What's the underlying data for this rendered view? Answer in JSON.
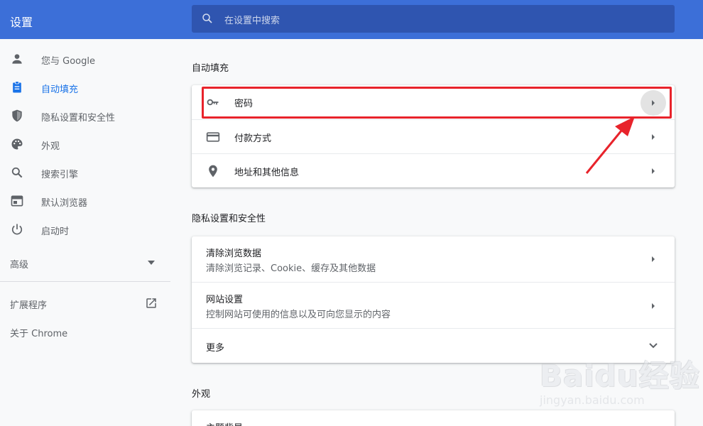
{
  "app": {
    "title": "设置"
  },
  "search": {
    "placeholder": "在设置中搜索"
  },
  "sidebar": {
    "items": [
      {
        "label": "您与 Google",
        "icon": "person-icon"
      },
      {
        "label": "自动填充",
        "icon": "clipboard-icon",
        "active": true
      },
      {
        "label": "隐私设置和安全性",
        "icon": "shield-icon"
      },
      {
        "label": "外观",
        "icon": "palette-icon"
      },
      {
        "label": "搜索引擎",
        "icon": "search-icon"
      },
      {
        "label": "默认浏览器",
        "icon": "browser-icon"
      },
      {
        "label": "启动时",
        "icon": "power-icon"
      }
    ],
    "advanced": "高级",
    "extensions": "扩展程序",
    "about": "关于 Chrome"
  },
  "sections": {
    "autofill": {
      "title": "自动填充",
      "rows": [
        {
          "label": "密码",
          "icon": "key-icon"
        },
        {
          "label": "付款方式",
          "icon": "credit-card-icon"
        },
        {
          "label": "地址和其他信息",
          "icon": "location-pin-icon"
        }
      ]
    },
    "privacy": {
      "title": "隐私设置和安全性",
      "rows": [
        {
          "label": "清除浏览数据",
          "sub": "清除浏览记录、Cookie、缓存及其他数据"
        },
        {
          "label": "网站设置",
          "sub": "控制网站可使用的信息以及可向您显示的内容"
        },
        {
          "label": "更多"
        }
      ]
    },
    "appearance": {
      "title": "外观",
      "rows": [
        {
          "label": "主题背景"
        }
      ]
    }
  },
  "watermark": {
    "logo": "Baidu经验",
    "url": "jingyan.baidu.com"
  },
  "colors": {
    "topbar": "#3c6fd8",
    "accent": "#1a73e8",
    "highlight": "#e8232b"
  }
}
